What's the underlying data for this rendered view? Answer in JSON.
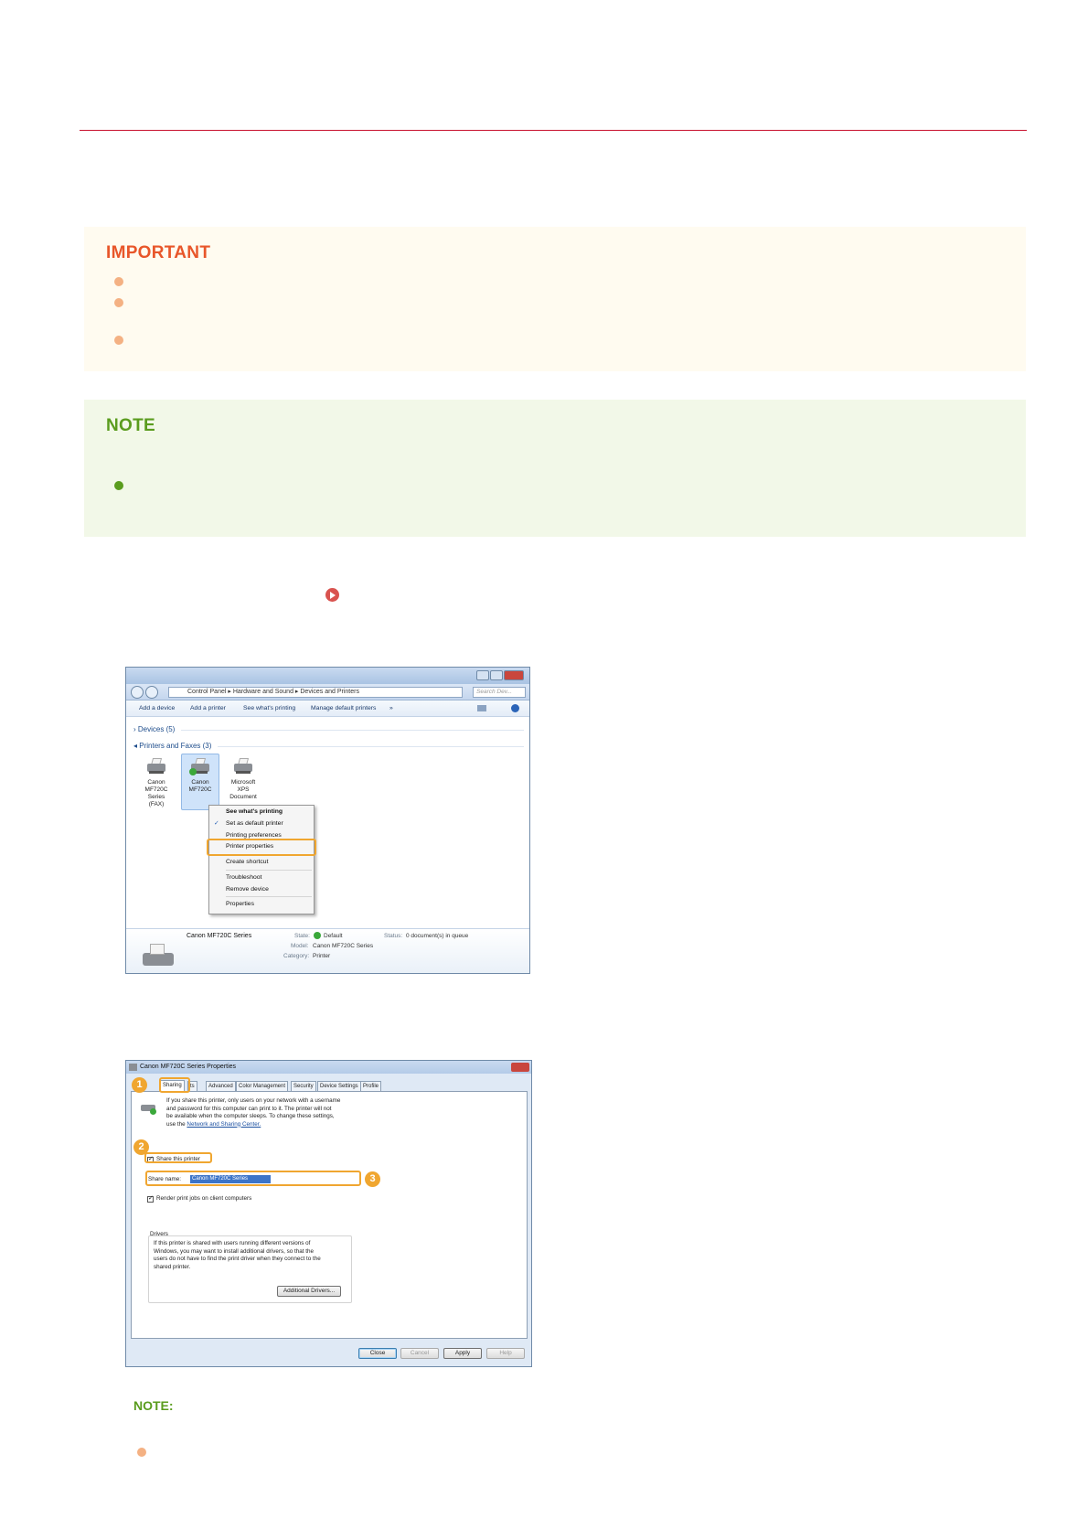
{
  "important": {
    "heading": "IMPORTANT",
    "colors": {
      "heading": "#e8562a",
      "background": "#fffbf0",
      "bullet": "#f4b183"
    },
    "bullet_count": 3
  },
  "note": {
    "heading": "NOTE",
    "colors": {
      "heading": "#5a9c1e",
      "background": "#f2f8e8",
      "bullet": "#5a9c1e"
    },
    "bullet_count": 1
  },
  "screenshot1": {
    "breadcrumb": "Control Panel  ▸  Hardware and Sound  ▸  Devices and Printers",
    "search_placeholder": "Search Dev...",
    "toolbar": [
      "Add a device",
      "Add a printer",
      "See what's printing",
      "Manage default printers",
      "»"
    ],
    "tree": {
      "devices": "Devices (5)",
      "printers": "Printers and Faxes (3)"
    },
    "printers": [
      {
        "line1": "Canon",
        "line2": "MF720C",
        "line3": "Series (FAX)"
      },
      {
        "line1": "Canon",
        "line2": "MF720C",
        "line3": ""
      },
      {
        "line1": "Microsoft",
        "line2": "XPS",
        "line3": "Document"
      }
    ],
    "context_menu": {
      "see_printing": "See what's printing",
      "set_default": "Set as default printer",
      "printing_prefs": "Printing preferences",
      "printer_props": "Printer properties",
      "create_shortcut": "Create shortcut",
      "troubleshoot": "Troubleshoot",
      "remove_device": "Remove device",
      "properties": "Properties"
    },
    "details": {
      "name": "Canon MF720C Series",
      "state_label": "State:",
      "state_value": "Default",
      "status_label": "Status:",
      "status_value": "0 document(s) in queue",
      "model_label": "Model:",
      "model_value": "Canon MF720C Series",
      "category_label": "Category:",
      "category_value": "Printer"
    }
  },
  "screenshot2": {
    "title": "Canon MF720C Series          Properties",
    "tabs": [
      "Sharing",
      "ts",
      "Advanced",
      "Color Management",
      "Security",
      "Device Settings",
      "Profile"
    ],
    "info_text": [
      "If you share this printer, only users on your network with a username",
      "and password for this computer can print to it. The printer will not",
      "be available when the computer sleeps. To change these settings,",
      "use the "
    ],
    "info_link": "Network and Sharing Center.",
    "share_printer": "Share this printer",
    "share_name_label": "Share name:",
    "share_name_value": "Canon MF720C Series",
    "render_jobs": "Render print jobs on client computers",
    "drivers_heading": "Drivers",
    "drivers_text": [
      "If this printer is shared with users running different versions of",
      "Windows, you may want to install additional drivers, so that the",
      "users do not have to find the print driver when they connect to the",
      "shared printer."
    ],
    "additional_drivers": "Additional Drivers...",
    "buttons": {
      "close": "Close",
      "cancel": "Cancel",
      "apply": "Apply",
      "help": "Help"
    },
    "badges": [
      "1",
      "2",
      "3"
    ]
  },
  "note2": {
    "heading": "NOTE:"
  },
  "accent": {
    "highlight": "#f0a630",
    "rule": "#c8102e",
    "link_circle": "#d9534f"
  }
}
